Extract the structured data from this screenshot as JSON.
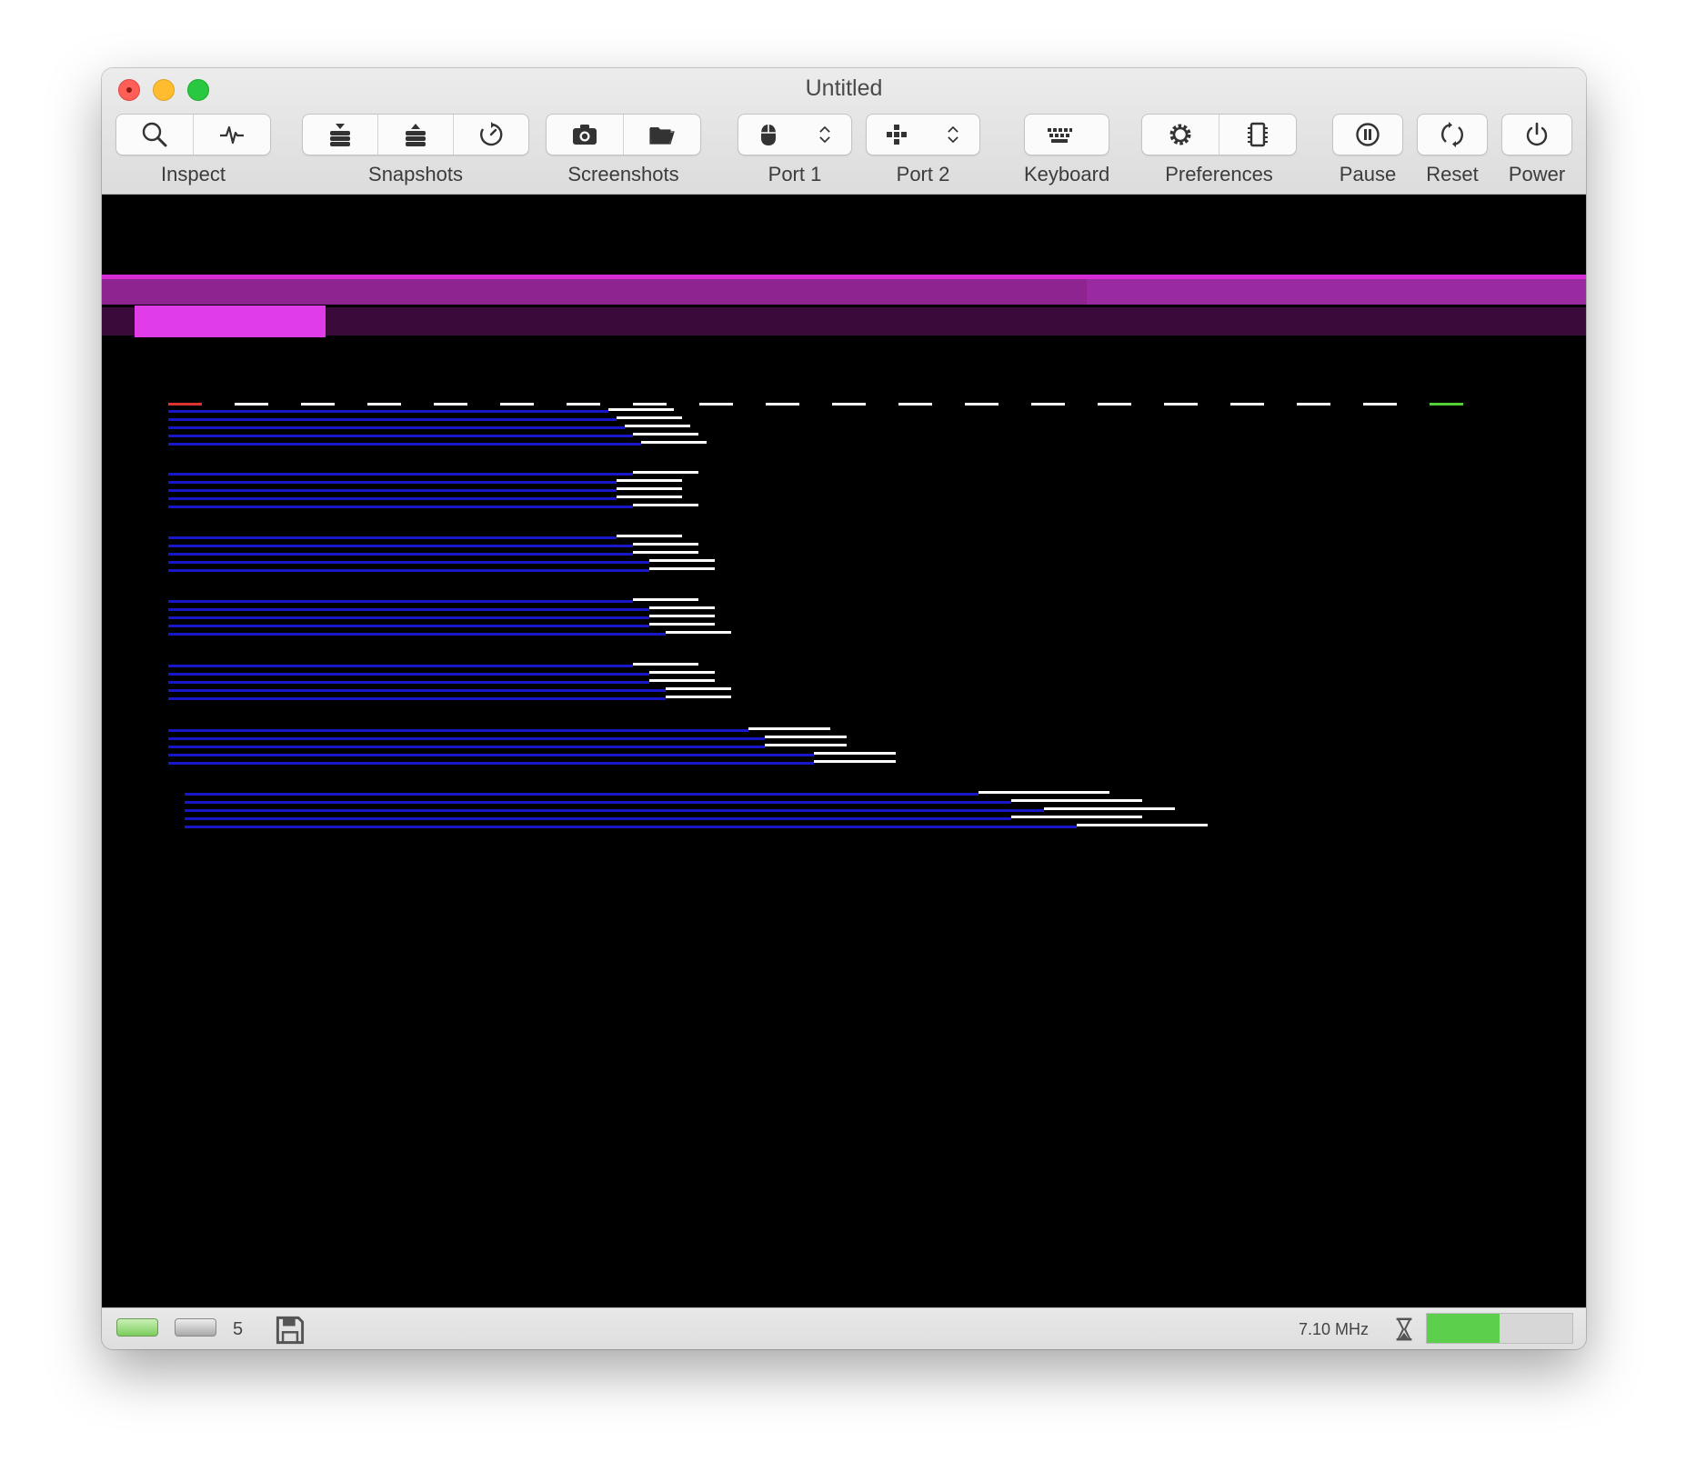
{
  "window": {
    "title": "Untitled"
  },
  "toolbar": {
    "groups": [
      {
        "label": "Inspect",
        "buttons": [
          {
            "icon": "magnifier-icon"
          },
          {
            "icon": "activity-pulse-icon"
          }
        ]
      },
      {
        "label": "Snapshots",
        "buttons": [
          {
            "icon": "snapshot-save-icon"
          },
          {
            "icon": "snapshot-restore-icon"
          },
          {
            "icon": "time-travel-icon"
          }
        ]
      },
      {
        "label": "Screenshots",
        "buttons": [
          {
            "icon": "camera-icon"
          },
          {
            "icon": "folder-icon"
          }
        ]
      },
      {
        "label": "Port 1",
        "buttons": [
          {
            "icon": "mouse-icon"
          },
          {
            "icon": "stepper-icon"
          }
        ]
      },
      {
        "label": "Port 2",
        "buttons": [
          {
            "icon": "joystick-icon"
          },
          {
            "icon": "stepper-icon"
          }
        ]
      },
      {
        "label": "Keyboard",
        "buttons": [
          {
            "icon": "keyboard-icon"
          }
        ]
      },
      {
        "label": "Preferences",
        "buttons": [
          {
            "icon": "gear-icon"
          },
          {
            "icon": "memory-chip-icon"
          }
        ]
      },
      {
        "label": "Pause",
        "buttons": [
          {
            "icon": "pause-icon"
          }
        ]
      },
      {
        "label": "Reset",
        "buttons": [
          {
            "icon": "reset-icon"
          }
        ]
      },
      {
        "label": "Power",
        "buttons": [
          {
            "icon": "power-icon"
          }
        ]
      }
    ]
  },
  "screen": {
    "colors": {
      "background": "#000000",
      "border_magenta": "#d62cd6",
      "border_purple": "#8e248f",
      "border_dark": "#3a0b3a",
      "highlight_magenta": "#e03ce8",
      "raster_blue": "#1818c8",
      "raster_white": "#ffffff",
      "marker_red": "#d33",
      "marker_green": "#52d036"
    }
  },
  "statusbar": {
    "drive_count": "5",
    "clock_speed": "7.10 MHz",
    "speed_level": 0.5,
    "icons": [
      "drive-led-green-icon",
      "drive-led-gray-icon",
      "floppy-disk-icon",
      "hourglass-icon"
    ]
  }
}
